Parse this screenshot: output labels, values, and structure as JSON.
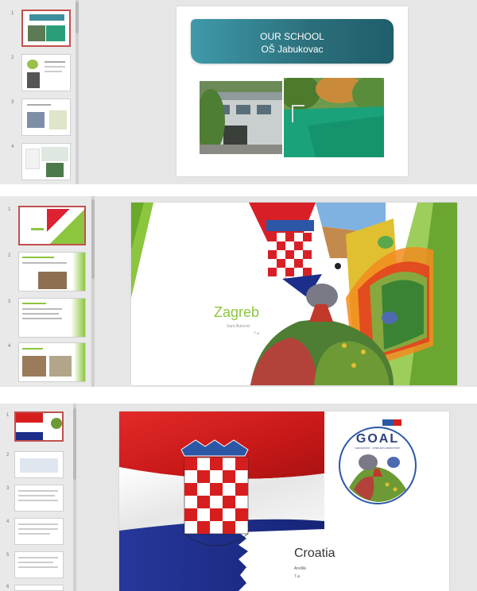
{
  "panels": [
    {
      "slide_numbers": [
        "1",
        "2",
        "3",
        "4"
      ],
      "main_slide": {
        "title_line1": "OUR SCHOOL",
        "title_line2": "OŠ Jabukovac",
        "banner_gradient": [
          "#3f9aaa",
          "#1f5e6a"
        ]
      }
    },
    {
      "slide_numbers": [
        "1",
        "2",
        "3",
        "4"
      ],
      "main_slide": {
        "title": "Zagreb",
        "subtitle": "Sara Buković",
        "subtitle2": "7.a",
        "accent": "#8cc63f"
      }
    },
    {
      "slide_numbers": [
        "1",
        "2",
        "3",
        "4",
        "5",
        "6"
      ],
      "main_slide": {
        "title": "Croatia",
        "subtitle": "Arvililá",
        "subtitle2": "7.a",
        "logo_text": "GOAL",
        "logo_subtext": "GEOGRAPHY · OPEN AIR LABORATORY",
        "flag_colors": [
          "#d71e1e",
          "#ffffff",
          "#1c2d8a"
        ]
      }
    }
  ]
}
